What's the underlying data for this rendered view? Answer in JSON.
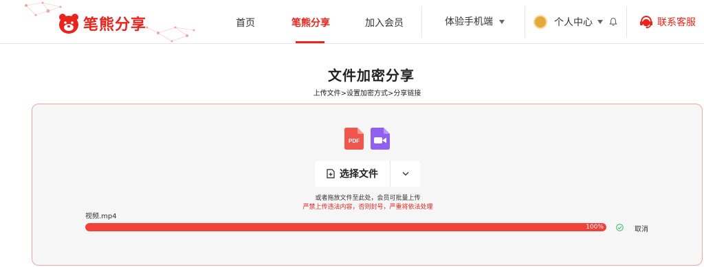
{
  "header": {
    "brand": "笔熊分享",
    "nav": {
      "home": "首页",
      "share": "笔熊分享",
      "vip": "加入会员",
      "mobile": "体验手机端"
    },
    "user_center": "个人中心",
    "service": "联系客服",
    "accent_color": "#e8241c"
  },
  "main": {
    "title": "文件加密分享",
    "steps": "上传文件>设置加密方式>分享链接",
    "file_type_icons": [
      "pdf-icon",
      "video-icon"
    ],
    "pdf_label": "PDF",
    "select_button": "选择文件",
    "hint": "或者拖放文件至此处，会员可批量上传",
    "warning": "严禁上传违法内容，否则封号，严重将依法处理",
    "upload": {
      "file_name": "视频.mp4",
      "progress": 100,
      "progress_label": "100%",
      "cancel": "取消"
    }
  }
}
